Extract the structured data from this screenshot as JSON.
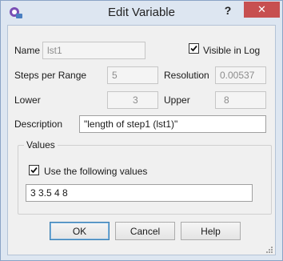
{
  "window": {
    "title": "Edit Variable",
    "help_glyph": "?",
    "close_glyph": "✕",
    "app_icon": "app-icon"
  },
  "form": {
    "name_label": "Name",
    "name_value": "lst1",
    "visible_in_log_label": "Visible in Log",
    "visible_in_log_checked": true,
    "steps_label": "Steps per Range",
    "steps_value": "5",
    "resolution_label": "Resolution",
    "resolution_value": "0.00537",
    "lower_label": "Lower",
    "lower_value": "3",
    "upper_label": "Upper",
    "upper_value": "8",
    "description_label": "Description",
    "description_value": "\"length of step1 (lst1)\""
  },
  "values_group": {
    "title": "Values",
    "use_values_label": "Use the following values",
    "use_values_checked": true,
    "values_text": "3 3.5 4 8"
  },
  "buttons": {
    "ok": "OK",
    "cancel": "Cancel",
    "help": "Help"
  },
  "colors": {
    "frame": "#dde6f1",
    "client": "#f0f0f0",
    "close": "#c75050"
  }
}
